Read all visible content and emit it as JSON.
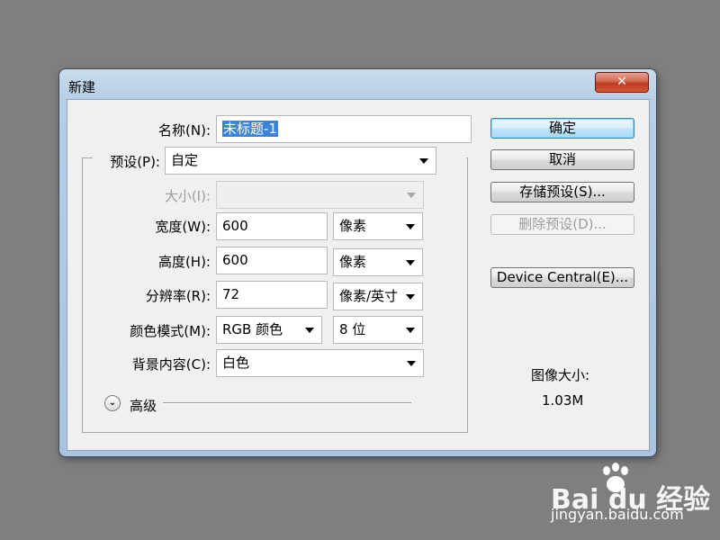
{
  "window": {
    "title": "新建",
    "close_label": "✕"
  },
  "form": {
    "name_label": "名称(N):",
    "name_value": "未标题-1",
    "preset_label": "预设(P):",
    "preset_value": "自定",
    "size_label": "大小(I):",
    "size_value": "",
    "width_label": "宽度(W):",
    "width_value": "600",
    "width_unit": "像素",
    "height_label": "高度(H):",
    "height_value": "600",
    "height_unit": "像素",
    "resolution_label": "分辨率(R):",
    "resolution_value": "72",
    "resolution_unit": "像素/英寸",
    "color_mode_label": "颜色模式(M):",
    "color_mode_value": "RGB 颜色",
    "bit_depth_value": "8 位",
    "background_label": "背景内容(C):",
    "background_value": "白色",
    "advanced_label": "高级"
  },
  "buttons": {
    "ok": "确定",
    "cancel": "取消",
    "save_preset": "存储预设(S)...",
    "delete_preset": "删除预设(D)...",
    "device_central": "Device Central(E)..."
  },
  "image_size": {
    "label": "图像大小:",
    "value": "1.03M"
  },
  "watermark": {
    "brand": "Bai du 经验",
    "url": "jingyan.baidu.com"
  }
}
